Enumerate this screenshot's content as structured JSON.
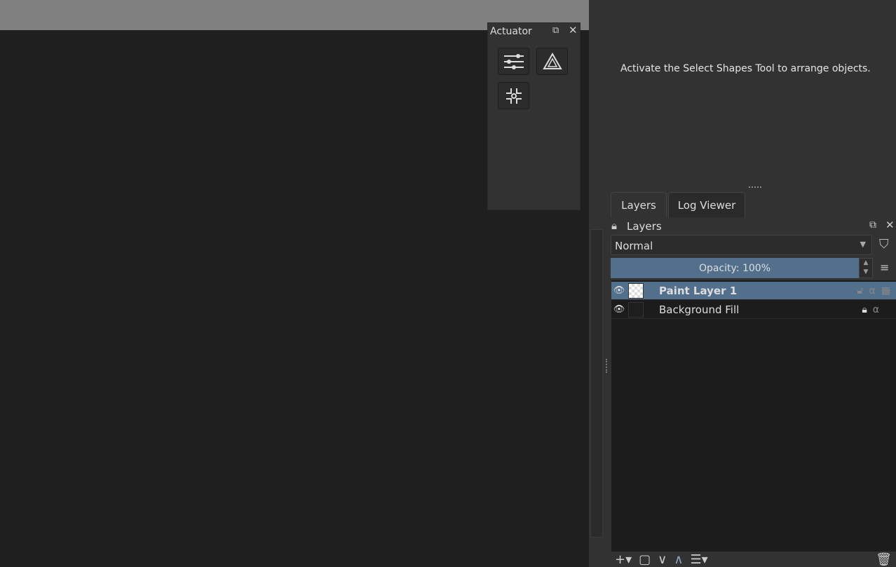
{
  "actuator": {
    "title": "Actuator",
    "buttons": [
      "sliders-icon",
      "triangle-icon",
      "center-icon"
    ]
  },
  "tool_options": {
    "message": "Activate the Select Shapes Tool to arrange objects."
  },
  "tabs": [
    {
      "label": "Layers"
    },
    {
      "label": "Log Viewer"
    }
  ],
  "layers_panel": {
    "title": "Layers",
    "blend_mode": "Normal",
    "opacity_label": "Opacity:  100%",
    "layers": [
      {
        "name": "Paint Layer 1",
        "selected": true
      },
      {
        "name": "Background Fill",
        "selected": false
      }
    ]
  },
  "colors": {
    "accent": "#526f8c",
    "canvas": "#1f1f1f",
    "panel": "#323232"
  }
}
